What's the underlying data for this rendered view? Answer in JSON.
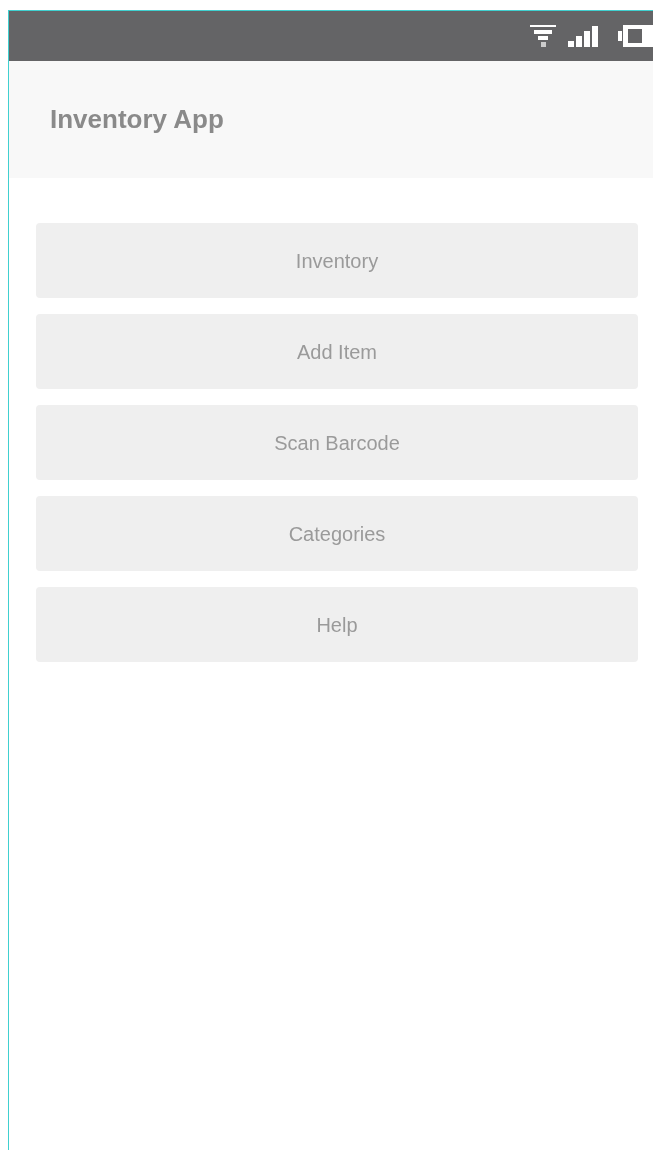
{
  "header": {
    "title": "Inventory App"
  },
  "menu": [
    {
      "label": "Inventory"
    },
    {
      "label": "Add Item"
    },
    {
      "label": "Scan Barcode"
    },
    {
      "label": "Categories"
    },
    {
      "label": "Help"
    }
  ]
}
